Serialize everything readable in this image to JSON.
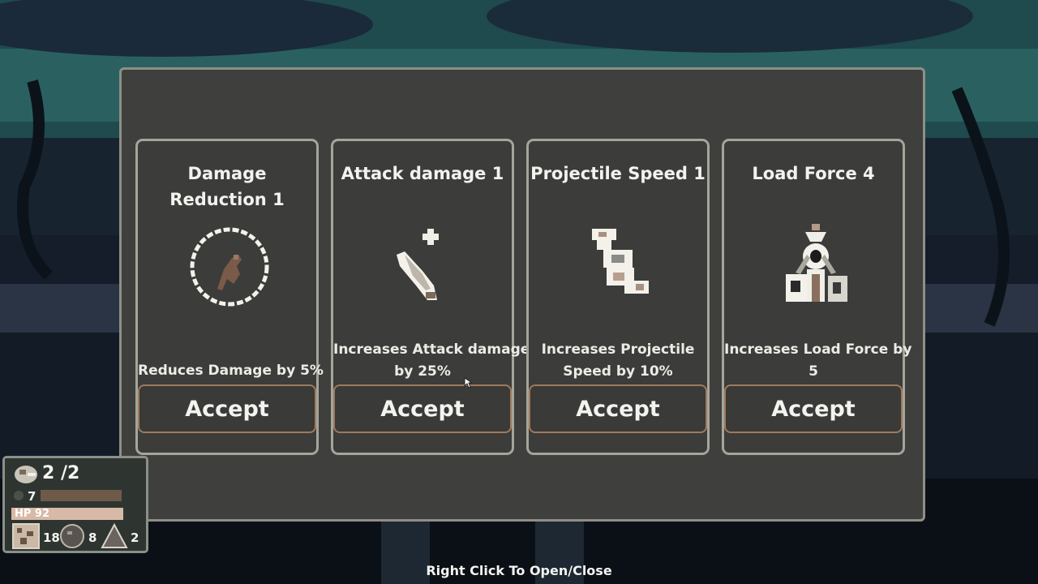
{
  "cards": [
    {
      "title": "Damage Reduction 1",
      "description": "Reduces Damage by 5%",
      "button": "Accept",
      "icon": "shield-circle-icon"
    },
    {
      "title": "Attack damage 1",
      "description_line1": "Increases Attack damage",
      "description_line2": "by 25%",
      "button": "Accept",
      "icon": "sword-icon"
    },
    {
      "title": "Projectile Speed 1",
      "description_line1": "Increases Projectile",
      "description_line2": "Speed by 10%",
      "button": "Accept",
      "icon": "projectile-icon"
    },
    {
      "title": "Load Force 4",
      "description_line1": "Increases Load Force by",
      "description_line2": "5",
      "button": "Accept",
      "icon": "load-force-icon"
    }
  ],
  "hud": {
    "lives": "2 /2",
    "gold": "7",
    "hp": "HP 92",
    "resources": [
      {
        "icon": "ore-icon",
        "count": "18"
      },
      {
        "icon": "stone-icon",
        "count": "8"
      },
      {
        "icon": "triangle-icon",
        "count": "2"
      }
    ]
  },
  "hint": "Right Click To Open/Close"
}
